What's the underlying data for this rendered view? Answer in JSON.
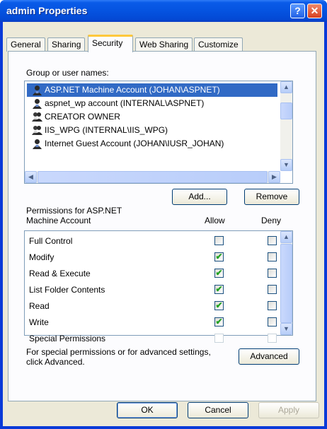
{
  "window": {
    "title": "admin Properties",
    "help_glyph": "?",
    "close_glyph": "✕"
  },
  "tabs": [
    "General",
    "Sharing",
    "Security",
    "Web Sharing",
    "Customize"
  ],
  "active_tab": "Security",
  "group_label": "Group or user names:",
  "users": [
    {
      "name": "ASP.NET Machine Account (JOHAN\\ASPNET)",
      "icon": "user-icon",
      "selected": true
    },
    {
      "name": "aspnet_wp account (INTERNAL\\ASPNET)",
      "icon": "user-icon",
      "selected": false
    },
    {
      "name": "CREATOR OWNER",
      "icon": "group-icon",
      "selected": false
    },
    {
      "name": "IIS_WPG (INTERNAL\\IIS_WPG)",
      "icon": "group-icon",
      "selected": false
    },
    {
      "name": "Internet Guest Account (JOHAN\\IUSR_JOHAN)",
      "icon": "user-icon",
      "selected": false
    }
  ],
  "buttons": {
    "add": "Add...",
    "remove": "Remove",
    "advanced": "Advanced",
    "ok": "OK",
    "cancel": "Cancel",
    "apply": "Apply"
  },
  "permissions": {
    "label_line1": "Permissions for ASP.NET",
    "label_line2": "Machine Account",
    "allow_header": "Allow",
    "deny_header": "Deny",
    "rows": [
      {
        "name": "Full Control",
        "allow": false,
        "deny": false
      },
      {
        "name": "Modify",
        "allow": true,
        "deny": false
      },
      {
        "name": "Read & Execute",
        "allow": true,
        "deny": false
      },
      {
        "name": "List Folder Contents",
        "allow": true,
        "deny": false
      },
      {
        "name": "Read",
        "allow": true,
        "deny": false
      },
      {
        "name": "Write",
        "allow": true,
        "deny": false
      },
      {
        "name": "Special Permissions",
        "allow": false,
        "deny": false
      }
    ]
  },
  "special_text_line1": "For special permissions or for advanced settings,",
  "special_text_line2": "click Advanced.",
  "colors": {
    "titlebar": "#0553e0",
    "selection": "#316ac5",
    "dialog_bg": "#ece9d8",
    "check": "#21a121"
  }
}
